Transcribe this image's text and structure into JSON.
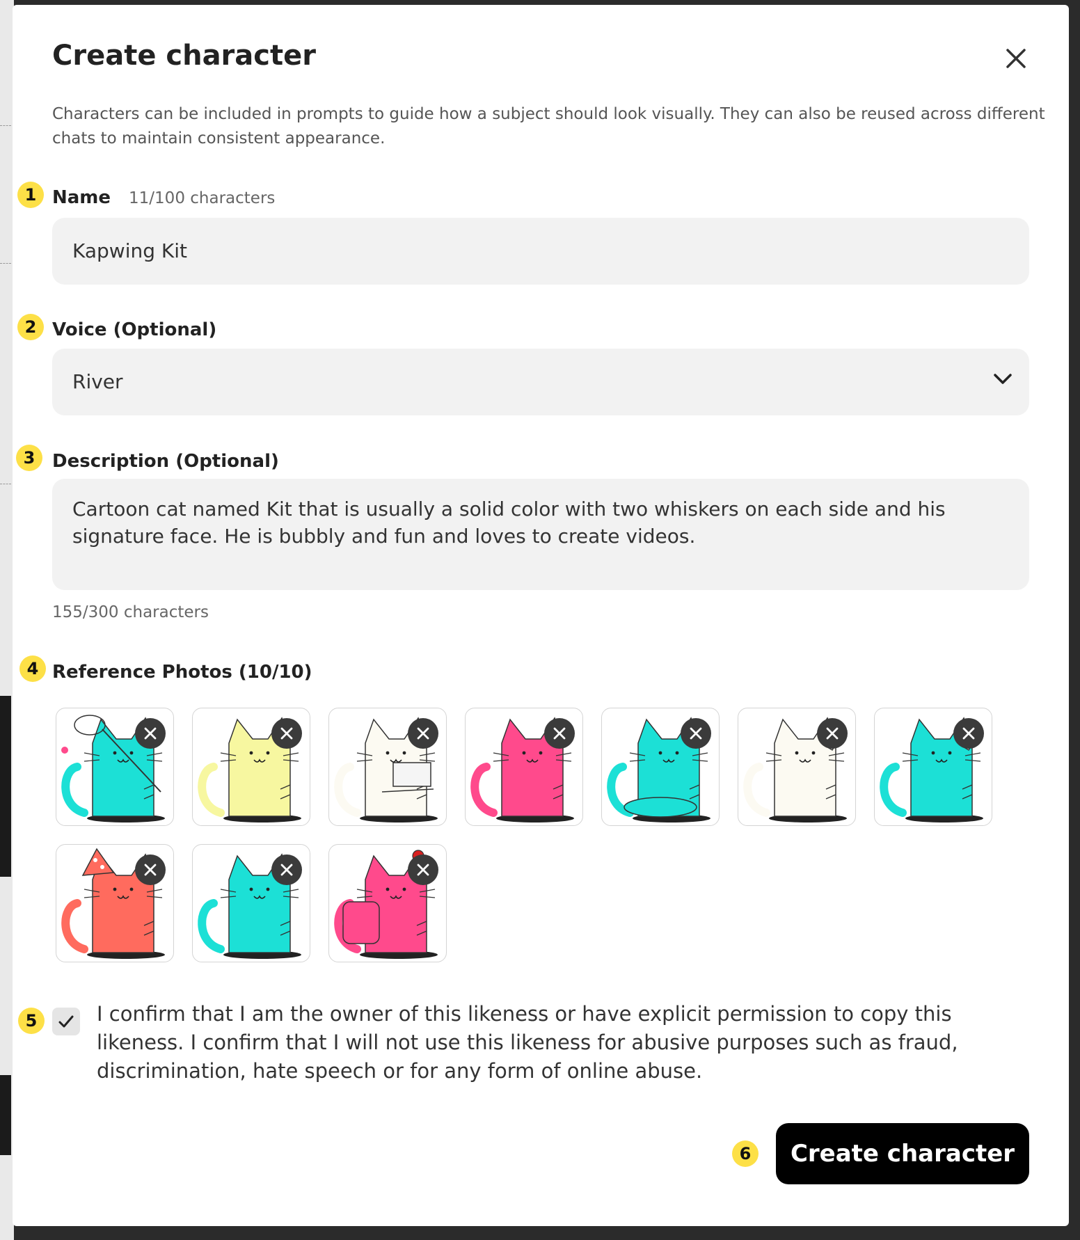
{
  "modal": {
    "title": "Create character",
    "description": "Characters can be included in prompts to guide how a subject should look visually. They can also be reused across different chats to maintain consistent appearance."
  },
  "name": {
    "label": "Name",
    "counter": "11/100 characters",
    "value": "Kapwing Kit",
    "badge": "1"
  },
  "voice": {
    "label": "Voice (Optional)",
    "value": "River",
    "badge": "2"
  },
  "description": {
    "label": "Description (Optional)",
    "value": "Cartoon cat named Kit that is usually a solid color with two whiskers on each side and his signature face. He is bubbly and fun and loves to create videos.",
    "counter": "155/300 characters",
    "badge": "3"
  },
  "reference_photos": {
    "label": "Reference Photos (10/10)",
    "badge": "4",
    "photos": [
      {
        "color": "#1ce0d6",
        "prop": "net"
      },
      {
        "color": "#f7f7a0",
        "prop": "none"
      },
      {
        "color": "#fcfaf2",
        "prop": "laptop"
      },
      {
        "color": "#ff4a8c",
        "prop": "wave"
      },
      {
        "color": "#1ce0d6",
        "prop": "meditate"
      },
      {
        "color": "#fcfaf2",
        "prop": "phone"
      },
      {
        "color": "#1ce0d6",
        "prop": "phone"
      },
      {
        "color": "#ff6b5e",
        "prop": "hat"
      },
      {
        "color": "#1ce0d6",
        "prop": "arms-up"
      },
      {
        "color": "#ff4a8c",
        "prop": "backpack"
      }
    ]
  },
  "consent": {
    "checked": true,
    "text": "I confirm that I am the owner of this likeness or have explicit permission to copy this likeness. I confirm that I will not use this likeness for abusive purposes such as fraud, discrimination, hate speech or for any form of online abuse.",
    "badge": "5"
  },
  "submit": {
    "label": "Create character",
    "badge": "6"
  }
}
